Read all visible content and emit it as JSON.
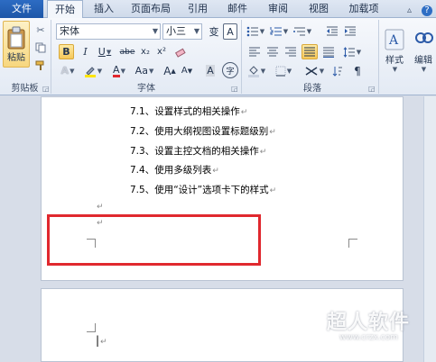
{
  "tabs": [
    "文件",
    "开始",
    "插入",
    "页面布局",
    "引用",
    "邮件",
    "审阅",
    "视图",
    "加载项"
  ],
  "ribbon": {
    "paste_label": "粘贴",
    "clipboard_group": "剪贴板",
    "font_group": "字体",
    "paragraph_group": "段落",
    "styles_label": "样式",
    "edit_label": "编辑",
    "font_name": "宋体",
    "font_size": "小三",
    "wen_char": "变",
    "a_box": "A",
    "bold": "B",
    "italic": "I",
    "underline": "U",
    "strike": "abe",
    "sub": "x₂",
    "sup": "x²",
    "aa_label": "Aa",
    "grow": "A",
    "shrink": "A",
    "circle_char": "字"
  },
  "document": {
    "toc_lines": [
      "7.1、设置样式的相关操作",
      "7.2、使用大纲视图设置标题级别",
      "7.3、设置主控文档的相关操作",
      "7.4、使用多级列表",
      "7.5、使用“设计”选项卡下的样式"
    ],
    "para_mark": "↵"
  },
  "watermark": {
    "title": "超人软件",
    "url": "www.crzx.com"
  }
}
